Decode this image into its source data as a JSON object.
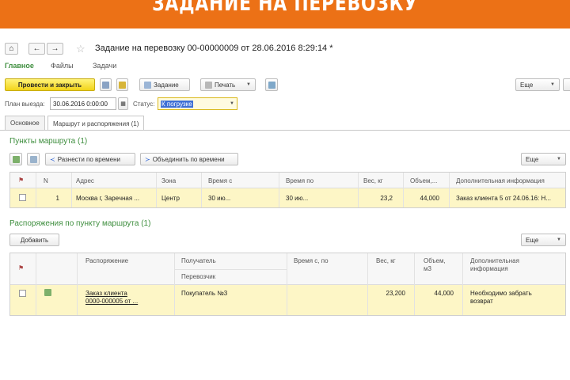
{
  "banner": {
    "title": "ЗАДАНИЕ НА ПЕРЕВОЗКУ"
  },
  "window": {
    "home_glyph": "⌂",
    "back_glyph": "←",
    "forward_glyph": "→",
    "favorite_glyph": "☆",
    "title": "Задание на перевозку 00-00000009 от 28.06.2016 8:29:14 *"
  },
  "menu": {
    "items": [
      "Главное",
      "Файлы",
      "Задачи"
    ]
  },
  "toolbar": {
    "post_close_label": "Провести и закрыть",
    "task_label": "Задание",
    "print_label": "Печать",
    "more_label": "Еще"
  },
  "fields": {
    "plan_label": "План выезда:",
    "plan_value": "30.06.2016  0:00:00",
    "status_label": "Статус:",
    "status_value": "К погрузке"
  },
  "tabs": [
    "Основное",
    "Маршрут и распоряжения (1)"
  ],
  "route_points": {
    "title": "Пункты маршрута (1)",
    "distribute_label": "Разнести по времени",
    "merge_label": "Объединить по времени",
    "more_label": "Еще",
    "columns": [
      "N",
      "Адрес",
      "Зона",
      "Время с",
      "Время по",
      "Вес, кг",
      "Объем,...",
      "Дополнительная информация"
    ],
    "rows": [
      {
        "n": "1",
        "address": "Москва г, Заречная ...",
        "zone": "Центр",
        "time_from": "30 ию...",
        "time_to": "30 ию...",
        "weight": "23,2",
        "volume": "44,000",
        "info": "Заказ клиента 5 от 24.06.16: Н..."
      }
    ]
  },
  "orders": {
    "title": "Распоряжения по пункту маршрута (1)",
    "add_label": "Добавить",
    "more_label": "Еще",
    "columns": {
      "order": "Распоряжение",
      "recipient": "Получатель",
      "carrier": "Перевозчик",
      "time_from": "Время с, по",
      "weight": "Вес, кг",
      "volume_l1": "Объем,",
      "volume_l2": "м3",
      "info_l1": "Дополнительная",
      "info_l2": "информация"
    },
    "rows": [
      {
        "order_l1": "Заказ клиента",
        "order_l2": "0000-000005 от ...",
        "recipient": "Покупатель №3",
        "weight": "23,200",
        "volume": "44,000",
        "info_l1": "Необходимо забрать",
        "info_l2": "возврат"
      }
    ]
  },
  "colors": {
    "banner": "#ec7116",
    "accent_green": "#3e8e3e",
    "primary_button": "#f2d418",
    "row_highlight": "#fdf6c6"
  }
}
